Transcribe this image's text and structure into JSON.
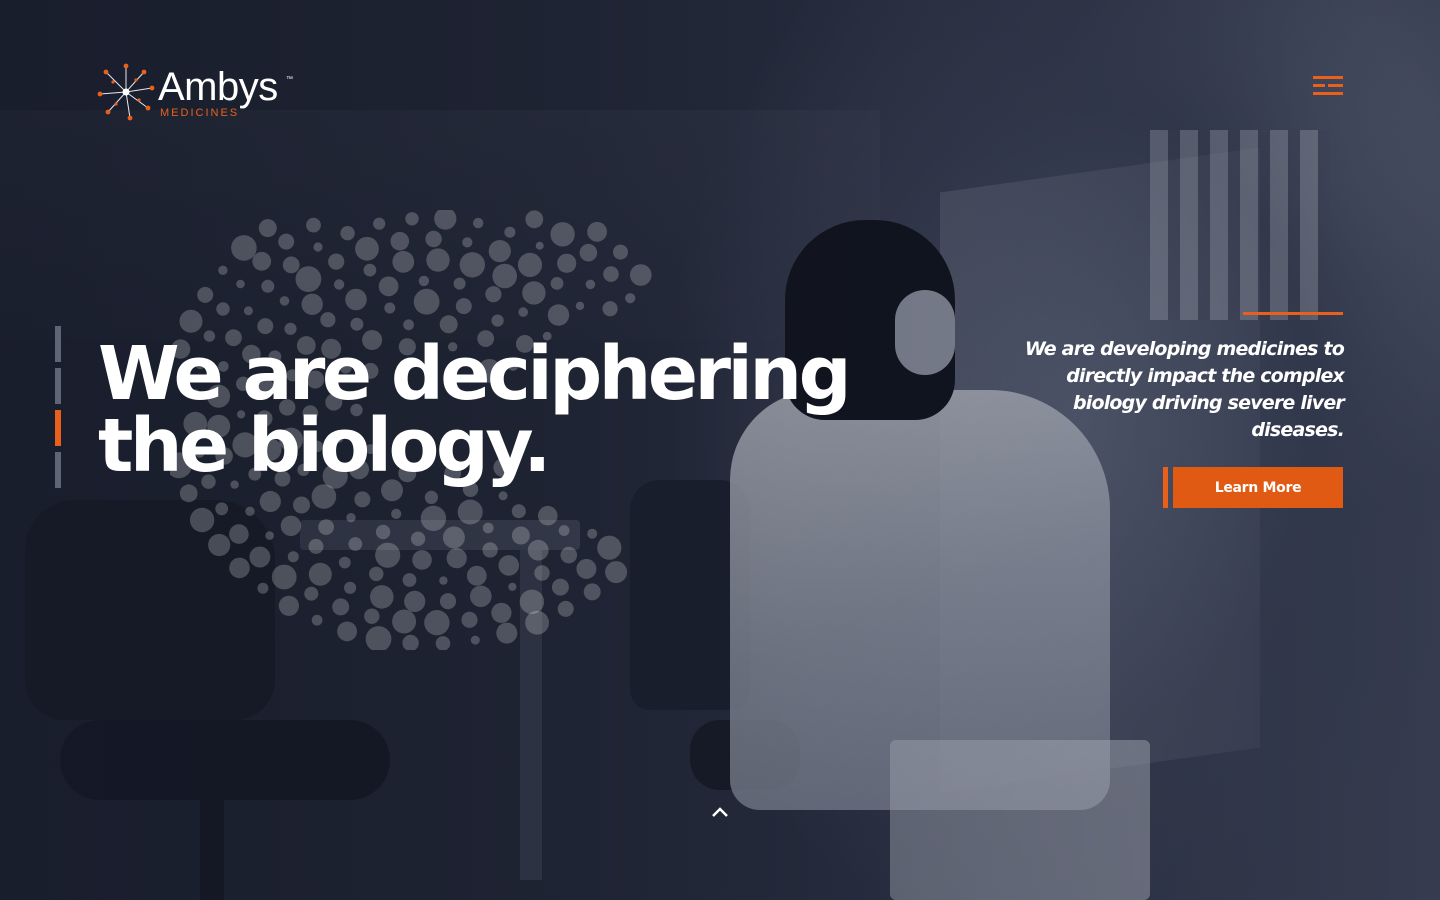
{
  "brand": {
    "name": "Ambys",
    "sub": "MEDICINES",
    "tm": "™",
    "accent_color": "#e8601c"
  },
  "header": {
    "menu_icon": "menu-icon"
  },
  "hero": {
    "headline_line1": "We are deciphering",
    "headline_line2": "the biology.",
    "tagline_line1": "We are developing medicines to",
    "tagline_line2": "directly impact the complex",
    "tagline_line3": "biology driving severe liver",
    "tagline_line4": "diseases.",
    "cta_label": "Learn More",
    "slide_count": 4,
    "active_slide": 3
  },
  "footer": {
    "scroll_icon": "chevron-up-icon"
  }
}
